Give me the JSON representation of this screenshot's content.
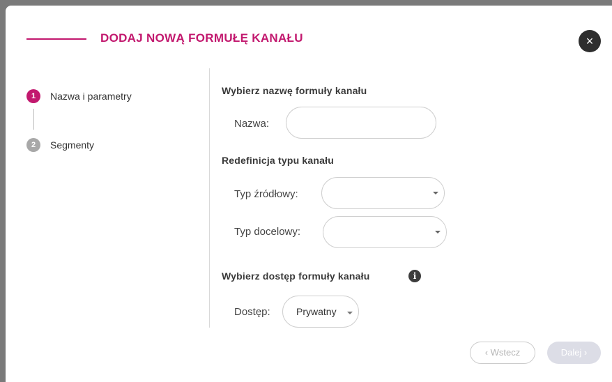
{
  "header": {
    "title": "DODAJ NOWĄ FORMUŁĘ KANAŁU",
    "close_glyph": "×"
  },
  "steps": [
    {
      "number": "1",
      "label": "Nazwa i parametry",
      "state": "active",
      "color": "#c2186e"
    },
    {
      "number": "2",
      "label": "Segmenty",
      "state": "inactive",
      "color": "#a8a8a8"
    }
  ],
  "form": {
    "name_section": {
      "title": "Wybierz nazwę formuły kanału",
      "name_label": "Nazwa:",
      "name_value": ""
    },
    "type_section": {
      "title": "Redefinicja typu kanału",
      "source_label": "Typ źródłowy:",
      "source_value": "",
      "target_label": "Typ docelowy:",
      "target_value": ""
    },
    "access_section": {
      "title": "Wybierz dostęp formuły kanału",
      "info_glyph": "i",
      "access_label": "Dostęp:",
      "access_value": "Prywatny"
    }
  },
  "footer": {
    "back_label": "‹ Wstecz",
    "next_label": "Dalej ›"
  },
  "colors": {
    "accent": "#c2186e",
    "inactive_step": "#a8a8a8",
    "disabled_button": "#dcdde6"
  },
  "icons": {
    "close": "close-icon",
    "info": "info-icon",
    "dropdown": "chevron-down-icon"
  }
}
